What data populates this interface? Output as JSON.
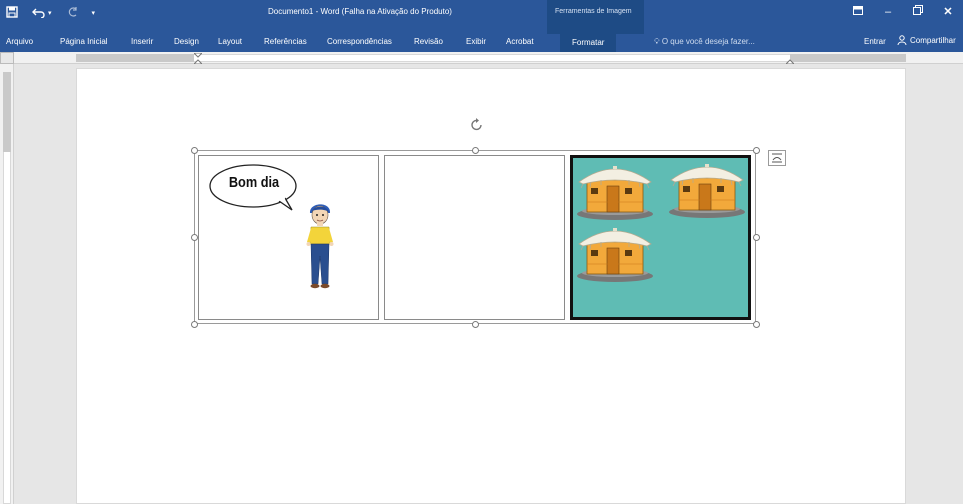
{
  "app": {
    "title": "Documento1 - Word (Falha na Ativação do Produto)",
    "context_tab_group": "Ferramentas de Imagem"
  },
  "qat": {
    "save_icon": "save-icon",
    "undo_icon": "undo-icon",
    "redo_icon": "redo-icon",
    "customize_icon": "customize-qat-icon"
  },
  "ribbon": {
    "tabs": [
      {
        "label": "Arquivo"
      },
      {
        "label": "Página Inicial"
      },
      {
        "label": "Inserir"
      },
      {
        "label": "Design"
      },
      {
        "label": "Layout"
      },
      {
        "label": "Referências"
      },
      {
        "label": "Correspondências"
      },
      {
        "label": "Revisão"
      },
      {
        "label": "Exibir"
      },
      {
        "label": "Acrobat"
      },
      {
        "label": "Formatar"
      }
    ],
    "tell_me": "O que você deseja fazer...",
    "sign_in": "Entrar",
    "share": "Compartilhar"
  },
  "document": {
    "speech_bubble_text": "Bom dia"
  },
  "colors": {
    "ribbon_blue": "#2b579a",
    "context_blue": "#1e4b85",
    "panel3_bg": "#5fbcb4",
    "hut_wall": "#f2a93b",
    "hut_roof": "#f3efe2"
  }
}
